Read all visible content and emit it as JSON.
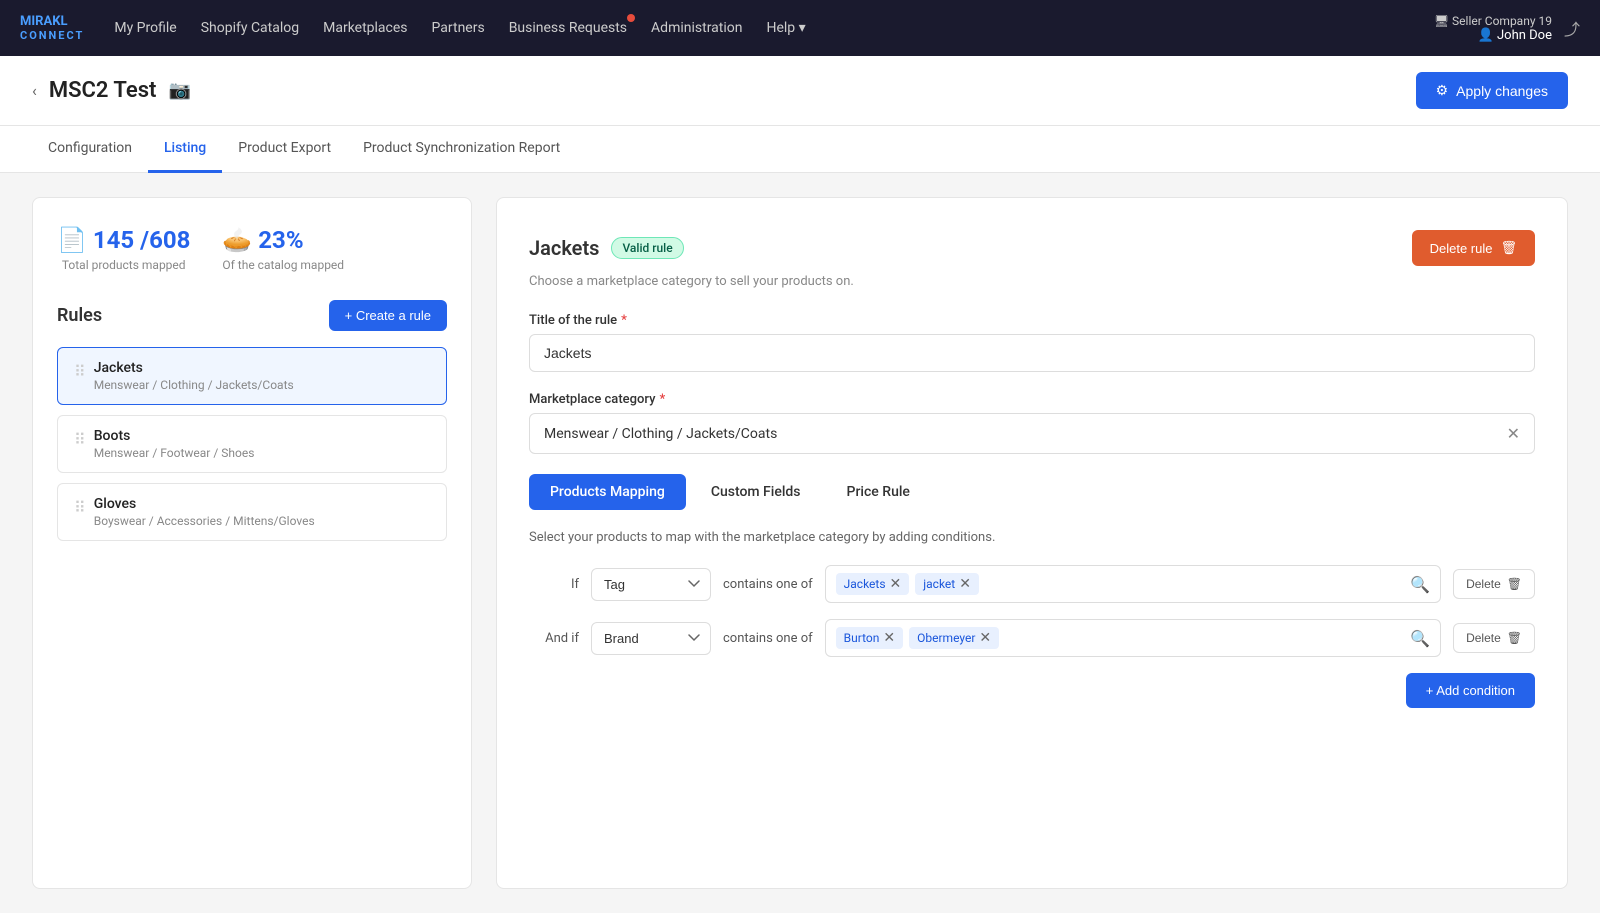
{
  "nav": {
    "logo_line1": "MIRAKL",
    "logo_line2": "CONNECT",
    "links": [
      {
        "label": "My Profile",
        "id": "my-profile",
        "badge": false
      },
      {
        "label": "Shopify Catalog",
        "id": "shopify-catalog",
        "badge": false
      },
      {
        "label": "Marketplaces",
        "id": "marketplaces",
        "badge": false
      },
      {
        "label": "Partners",
        "id": "partners",
        "badge": false
      },
      {
        "label": "Business Requests",
        "id": "business-requests",
        "badge": true
      },
      {
        "label": "Administration",
        "id": "administration",
        "badge": false
      },
      {
        "label": "Help",
        "id": "help",
        "badge": false,
        "dropdown": true
      }
    ],
    "user": {
      "company": "Seller Company 19",
      "name": "John Doe"
    }
  },
  "page": {
    "back_label": "‹",
    "title": "MSC2 Test",
    "camera_icon": "📷"
  },
  "apply_changes_btn": "Apply changes",
  "tabs": [
    {
      "label": "Configuration",
      "id": "configuration",
      "active": false
    },
    {
      "label": "Listing",
      "id": "listing",
      "active": true
    },
    {
      "label": "Product Export",
      "id": "product-export",
      "active": false
    },
    {
      "label": "Product Synchronization Report",
      "id": "product-sync",
      "active": false
    }
  ],
  "left_panel": {
    "stats": [
      {
        "icon": "📄",
        "value": "145 /608",
        "label": "Total products mapped"
      },
      {
        "icon": "🥧",
        "value": "23%",
        "label": "Of the catalog mapped"
      }
    ],
    "rules_title": "Rules",
    "create_rule_btn": "+ Create a rule",
    "rules": [
      {
        "name": "Jackets",
        "path": "Menswear / Clothing / Jackets/Coats",
        "active": true
      },
      {
        "name": "Boots",
        "path": "Menswear / Footwear / Shoes",
        "active": false
      },
      {
        "name": "Gloves",
        "path": "Boyswear / Accessories / Mittens/Gloves",
        "active": false
      }
    ]
  },
  "right_panel": {
    "rule_title": "Jackets",
    "rule_badge": "Valid rule",
    "delete_rule_btn": "Delete rule",
    "rule_subtitle": "Choose a marketplace category to sell your products on.",
    "form": {
      "title_label": "Title of the rule",
      "title_value": "Jackets",
      "title_placeholder": "Jackets",
      "category_label": "Marketplace category",
      "category_value": "Menswear / Clothing / Jackets/Coats"
    },
    "sub_tabs": [
      {
        "label": "Products Mapping",
        "active": true
      },
      {
        "label": "Custom Fields",
        "active": false
      },
      {
        "label": "Price Rule",
        "active": false
      }
    ],
    "mapping_desc": "Select your products to map with the marketplace category by adding conditions.",
    "conditions": [
      {
        "prefix": "If",
        "field": "Tag",
        "operator": "contains one of",
        "tags": [
          {
            "label": "Jackets"
          },
          {
            "label": "jacket"
          }
        ]
      },
      {
        "prefix": "And if",
        "field": "Brand",
        "operator": "contains one of",
        "tags": [
          {
            "label": "Burton"
          },
          {
            "label": "Obermeyer"
          }
        ]
      }
    ],
    "add_condition_btn": "+ Add condition",
    "delete_label": "Delete"
  }
}
